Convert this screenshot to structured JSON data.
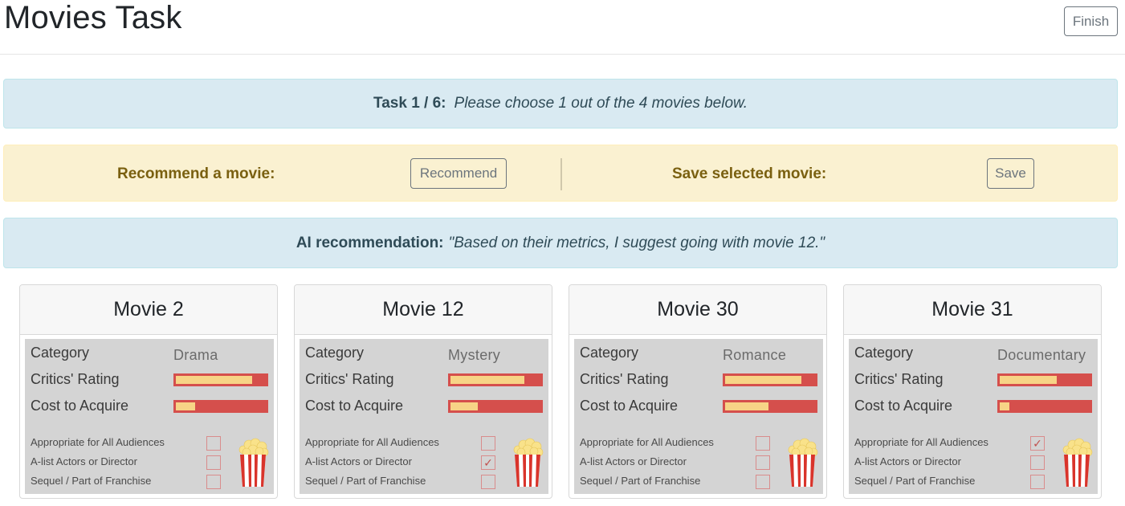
{
  "header": {
    "title": "Movies Task",
    "finish_label": "Finish"
  },
  "task": {
    "progress": "Task 1 / 6:",
    "instruction": "Please choose 1 out of the 4 movies below."
  },
  "actions": {
    "recommend_text": "Recommend a movie:",
    "recommend_button": "Recommend",
    "save_text": "Save selected movie:",
    "save_button": "Save"
  },
  "ai": {
    "label": "AI recommendation:",
    "quote": "\"Based on their metrics, I suggest going with movie 12.\""
  },
  "labels": {
    "category": "Category",
    "critics_rating": "Critics' Rating",
    "cost": "Cost to Acquire",
    "all_audiences": "Appropriate for All Audiences",
    "a_list": "A-list Actors or Director",
    "sequel": "Sequel / Part of Franchise"
  },
  "colors": {
    "bar_bg": "#d54f4c",
    "bar_fill": "#f7d486",
    "panel": "#d4d4d4"
  },
  "movies": [
    {
      "title": "Movie 2",
      "category": "Drama",
      "critics_rating": 0.85,
      "cost": 0.21,
      "all_audiences": false,
      "a_list": false,
      "sequel": false
    },
    {
      "title": "Movie 12",
      "category": "Mystery",
      "critics_rating": 0.82,
      "cost": 0.3,
      "all_audiences": false,
      "a_list": true,
      "sequel": false
    },
    {
      "title": "Movie 30",
      "category": "Romance",
      "critics_rating": 0.85,
      "cost": 0.48,
      "all_audiences": false,
      "a_list": false,
      "sequel": false
    },
    {
      "title": "Movie 31",
      "category": "Documentary",
      "critics_rating": 0.63,
      "cost": 0.11,
      "all_audiences": true,
      "a_list": false,
      "sequel": false
    }
  ]
}
